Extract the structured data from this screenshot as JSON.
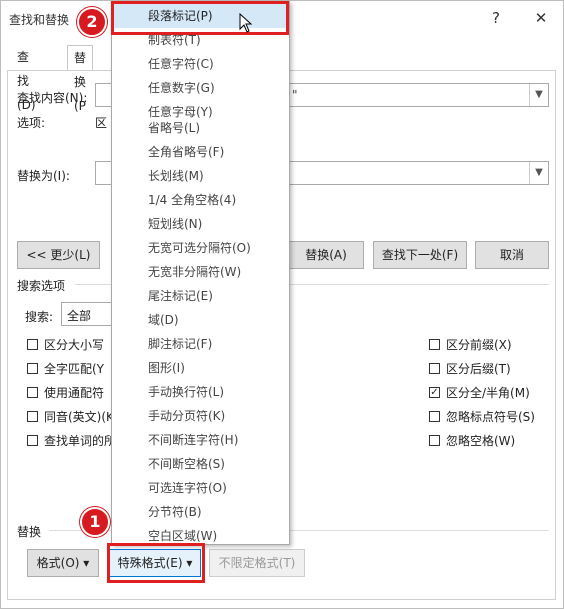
{
  "title": "查找和替换",
  "titlebar": {
    "help": "?",
    "close": "✕"
  },
  "tabs": [
    {
      "label": "查找(D)"
    },
    {
      "label": "替换(P"
    }
  ],
  "find": {
    "label": "查找内容(N):",
    "value_partial": "\"",
    "options_label": "选项:",
    "options_value_partial": "区"
  },
  "replace": {
    "label": "替换为(I):"
  },
  "buttons": {
    "less": "<< 更少(L)",
    "replace": "替换(A)",
    "find_next": "查找下一处(F)",
    "cancel": "取消"
  },
  "search_options": {
    "title": "搜索选项",
    "search_label": "搜索:",
    "search_value": "全部",
    "left_checks": [
      {
        "label": "区分大小写",
        "checked": false
      },
      {
        "label": "全字匹配(Y",
        "checked": false
      },
      {
        "label": "使用通配符",
        "checked": false
      },
      {
        "label": "同音(英文)(K",
        "checked": false
      },
      {
        "label": "查找单词的所",
        "checked": false
      }
    ],
    "right_checks": [
      {
        "label": "区分前缀(X)",
        "checked": false
      },
      {
        "label": "区分后缀(T)",
        "checked": false
      },
      {
        "label": "区分全/半角(M)",
        "checked": true
      },
      {
        "label": "忽略标点符号(S)",
        "checked": false
      },
      {
        "label": "忽略空格(W)",
        "checked": false
      }
    ]
  },
  "replace_section": {
    "title": "替换",
    "format": "格式(O) ▾",
    "special": "特殊格式(E) ▾",
    "no_format": "不限定格式(T)"
  },
  "menu": {
    "items": [
      "段落标记(P)",
      "制表符(T)",
      "任意字符(C)",
      "任意数字(G)",
      "任意字母(Y)",
      "省略号(L)",
      "全角省略号(F)",
      "长划线(M)",
      "1/4 全角空格(4)",
      "短划线(N)",
      "无宽可选分隔符(O)",
      "无宽非分隔符(W)",
      "尾注标记(E)",
      "域(D)",
      "脚注标记(F)",
      "图形(I)",
      "手动换行符(L)",
      "手动分页符(K)",
      "不间断连字符(H)",
      "不间断空格(S)",
      "可选连字符(O)",
      "分节符(B)",
      "空白区域(W)"
    ],
    "highlighted_index": 0
  },
  "annotations": {
    "badge1": "1",
    "badge2": "2",
    "accent": "#e02020"
  }
}
